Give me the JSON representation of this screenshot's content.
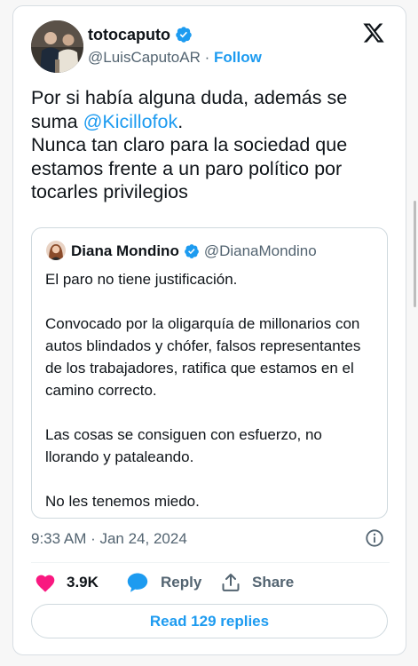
{
  "author": {
    "display_name": "totocaputo",
    "handle": "@LuisCaputoAR",
    "separator": "·",
    "follow_label": "Follow"
  },
  "tweet": {
    "text_before": "Por si había alguna duda, además se suma ",
    "mention": "@Kicillofok",
    "text_after": ".\nNunca tan claro para la sociedad que estamos frente a un paro político por tocarles privilegios"
  },
  "quoted": {
    "display_name": "Diana Mondino",
    "handle": "@DianaMondino",
    "paragraphs": [
      "El paro no tiene justificación.",
      "Convocado por la oligarquía de millonarios con autos blindados y chófer, falsos representantes de los trabajadores, ratifica que estamos en el camino correcto.",
      "Las cosas se consiguen con esfuerzo, no llorando y pataleando.",
      "No les tenemos miedo."
    ]
  },
  "meta": {
    "timestamp": "9:33 AM · Jan 24, 2024"
  },
  "actions": {
    "like_count": "3.9K",
    "reply_label": "Reply",
    "share_label": "Share"
  },
  "read_replies_label": "Read 129 replies",
  "colors": {
    "accent": "#1d9bf0",
    "like": "#f91880",
    "text": "#0f1419",
    "secondary": "#536471"
  },
  "icons": [
    "verified-badge-icon",
    "x-logo-icon",
    "info-icon",
    "heart-icon",
    "reply-bubble-icon",
    "share-icon"
  ]
}
